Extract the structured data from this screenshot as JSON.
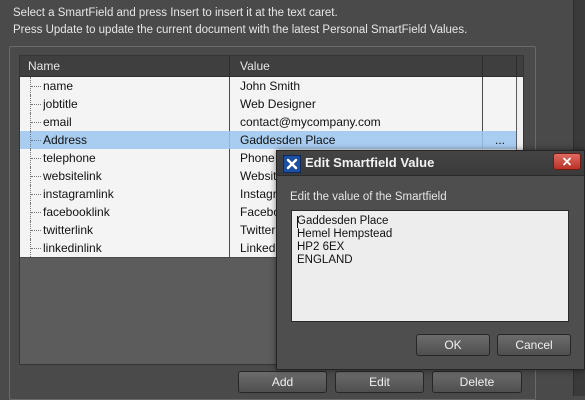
{
  "instructions": {
    "line1": "Select a SmartField and press Insert to insert it at the text caret.",
    "line2": "Press Update to update the current document with the latest Personal SmartField Values."
  },
  "table": {
    "columns": [
      "Name",
      "Value"
    ],
    "rows": [
      {
        "name": "name",
        "value": "John Smith",
        "edit": ""
      },
      {
        "name": "jobtitle",
        "value": "Web Designer",
        "edit": ""
      },
      {
        "name": "email",
        "value": "contact@mycompany.com",
        "edit": ""
      },
      {
        "name": "Address",
        "value": "Gaddesden Place",
        "edit": "...",
        "selected": true
      },
      {
        "name": "telephone",
        "value": "Phone",
        "edit": ""
      },
      {
        "name": "websitelink",
        "value": "Websit",
        "edit": ""
      },
      {
        "name": "instagramlink",
        "value": "Instagr",
        "edit": ""
      },
      {
        "name": "facebooklink",
        "value": "Facebo",
        "edit": ""
      },
      {
        "name": "twitterlink",
        "value": "Twitter",
        "edit": ""
      },
      {
        "name": "linkedinlink",
        "value": "Linked",
        "edit": ""
      }
    ]
  },
  "buttons": {
    "add": "Add",
    "edit": "Edit",
    "delete": "Delete"
  },
  "dialog": {
    "title": "Edit Smartfield Value",
    "label": "Edit the value of the Smartfield",
    "value_lines": [
      "Gaddesden Place",
      "Hemel Hempstead",
      "HP2 6EX",
      "ENGLAND"
    ],
    "ok": "OK",
    "cancel": "Cancel"
  },
  "colors": {
    "selection": "#a9cdf1",
    "background": "#4a4a4a",
    "close_button": "#c9433a",
    "title_icon": "#1f4fa0"
  }
}
